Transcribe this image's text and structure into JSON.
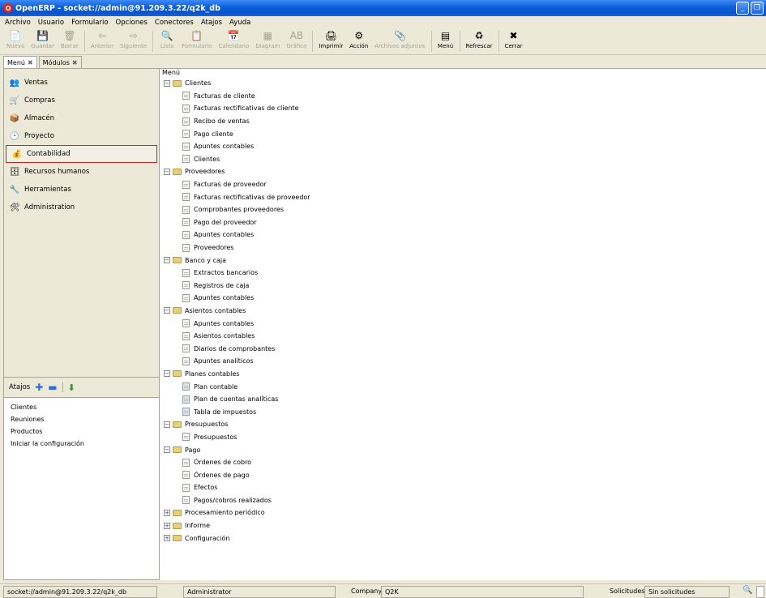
{
  "window": {
    "title": "OpenERP - socket://admin@91.209.3.22/q2k_db"
  },
  "menubar": [
    "Archivo",
    "Usuario",
    "Formulario",
    "Opciones",
    "Conectores",
    "Atajos",
    "Ayuda"
  ],
  "toolbar": [
    {
      "label": "Nuevo",
      "icon": "📄",
      "disabled": true
    },
    {
      "label": "Guardar",
      "icon": "💾",
      "disabled": true
    },
    {
      "label": "Borrar",
      "icon": "🗑",
      "disabled": true
    },
    {
      "sep": true
    },
    {
      "label": "Anterior",
      "icon": "⇦",
      "disabled": true
    },
    {
      "label": "Siguiente",
      "icon": "⇨",
      "disabled": true
    },
    {
      "sep": true
    },
    {
      "label": "Lista",
      "icon": "🔍",
      "disabled": true
    },
    {
      "label": "Formulario",
      "icon": "📋",
      "disabled": true
    },
    {
      "label": "Calendario",
      "icon": "📅",
      "disabled": true
    },
    {
      "label": "Diagram",
      "icon": "▦",
      "disabled": true
    },
    {
      "label": "Gráfico",
      "icon": "AB",
      "disabled": true
    },
    {
      "sep": true
    },
    {
      "label": "Imprimir",
      "icon": "🖨",
      "disabled": false
    },
    {
      "label": "Acción",
      "icon": "⚙",
      "disabled": false
    },
    {
      "label": "Archivos adjuntos",
      "icon": "📎",
      "disabled": true
    },
    {
      "sep": true
    },
    {
      "label": "Menú",
      "icon": "▤",
      "disabled": false
    },
    {
      "sep": true
    },
    {
      "label": "Refrescar",
      "icon": "♻",
      "disabled": false
    },
    {
      "sep": true
    },
    {
      "label": "Cerrar",
      "icon": "✖",
      "disabled": false
    }
  ],
  "tabs": [
    {
      "label": "Menú"
    },
    {
      "label": "Módulos"
    }
  ],
  "modules": [
    {
      "label": "Ventas",
      "icon": "👥",
      "selected": false
    },
    {
      "label": "Compras",
      "icon": "🛒",
      "selected": false
    },
    {
      "label": "Almacén",
      "icon": "📦",
      "selected": false
    },
    {
      "label": "Proyecto",
      "icon": "🕒",
      "selected": false
    },
    {
      "label": "Contabilidad",
      "icon": "💰",
      "selected": true
    },
    {
      "label": "Recursos humanos",
      "icon": "🗄",
      "selected": false
    },
    {
      "label": "Herramientas",
      "icon": "🔧",
      "selected": false
    },
    {
      "label": "Administration",
      "icon": "🛠",
      "selected": false
    }
  ],
  "shortcuts": {
    "title": "Atajos",
    "items": [
      "Clientes",
      "Reuniones",
      "Productos",
      "Iniciar la configuración"
    ]
  },
  "tree": {
    "header": "Menú",
    "nodes": [
      {
        "t": "folder",
        "label": "Clientes",
        "exp": "−"
      },
      {
        "t": "leaf",
        "label": "Facturas de cliente"
      },
      {
        "t": "leaf",
        "label": "Facturas rectificativas de cliente"
      },
      {
        "t": "leaf",
        "label": "Recibo de ventas"
      },
      {
        "t": "leaf",
        "label": "Pago cliente"
      },
      {
        "t": "leaf",
        "label": "Apuntes contables"
      },
      {
        "t": "leaf",
        "label": "Clientes"
      },
      {
        "t": "folder",
        "label": "Proveedores",
        "exp": "−"
      },
      {
        "t": "leaf",
        "label": "Facturas de proveedor"
      },
      {
        "t": "leaf",
        "label": "Facturas rectificativas de proveedor"
      },
      {
        "t": "leaf",
        "label": "Comprobantes proveedores"
      },
      {
        "t": "leaf",
        "label": "Pago del proveedor"
      },
      {
        "t": "leaf",
        "label": "Apuntes contables"
      },
      {
        "t": "leaf",
        "label": "Proveedores"
      },
      {
        "t": "folder",
        "label": "Banco y caja",
        "exp": "−"
      },
      {
        "t": "leaf",
        "label": "Extractos bancarios"
      },
      {
        "t": "leaf",
        "label": "Registros de caja"
      },
      {
        "t": "leaf",
        "label": "Apuntes contables"
      },
      {
        "t": "folder",
        "label": "Asientos contables",
        "exp": "−"
      },
      {
        "t": "leaf",
        "label": "Apuntes contables"
      },
      {
        "t": "leaf",
        "label": "Asientos contables"
      },
      {
        "t": "leaf",
        "label": "Diarios de comprobantes"
      },
      {
        "t": "leaf",
        "label": "Apuntes analíticos"
      },
      {
        "t": "folder",
        "label": "Planes contables",
        "exp": "−"
      },
      {
        "t": "table",
        "label": "Plan contable"
      },
      {
        "t": "table",
        "label": "Plan de cuentas analíticas"
      },
      {
        "t": "table",
        "label": "Tabla de impuestos"
      },
      {
        "t": "folder",
        "label": "Presupuestos",
        "exp": "−"
      },
      {
        "t": "leaf",
        "label": "Presupuestos"
      },
      {
        "t": "folder",
        "label": "Pago",
        "exp": "−"
      },
      {
        "t": "leaf",
        "label": "Órdenes de cobro"
      },
      {
        "t": "leaf",
        "label": "Órdenes de pago"
      },
      {
        "t": "leaf",
        "label": "Efectos"
      },
      {
        "t": "leaf",
        "label": "Pagos/cobros realizados"
      },
      {
        "t": "folder",
        "label": "Procesamiento periódico",
        "exp": "+"
      },
      {
        "t": "folder",
        "label": "Informe",
        "exp": "+"
      },
      {
        "t": "folder",
        "label": "Configuración",
        "exp": "+"
      }
    ]
  },
  "statusbar": {
    "connection": "socket://admin@91.209.3.22/q2k_db",
    "user": "Administrator",
    "company_label": "Company:",
    "company": "Q2K",
    "requests_label": "Solicitudes:",
    "requests": "Sin solicitudes"
  }
}
